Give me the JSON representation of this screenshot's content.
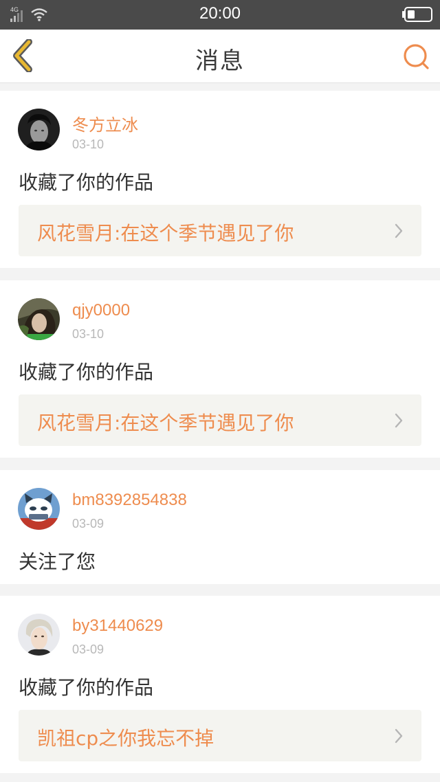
{
  "status_bar": {
    "time": "20:00",
    "network": "4G"
  },
  "header": {
    "title": "消息"
  },
  "colors": {
    "accent": "#ee8c4e",
    "nav_icon": "#e8b832",
    "status_bar": "#4a4a4a"
  },
  "messages": [
    {
      "username": "冬方立冰",
      "date": "03-10",
      "action": "收藏了你的作品",
      "work_title": "风花雪月:在这个季节遇见了你"
    },
    {
      "username": "qjy0000",
      "date": "03-10",
      "action": "收藏了你的作品",
      "work_title": "风花雪月:在这个季节遇见了你"
    },
    {
      "username": "bm8392854838",
      "date": "03-09",
      "action": "关注了您"
    },
    {
      "username": "by31440629",
      "date": "03-09",
      "action": "收藏了你的作品",
      "work_title": "凯祖cp之你我忘不掉"
    }
  ]
}
